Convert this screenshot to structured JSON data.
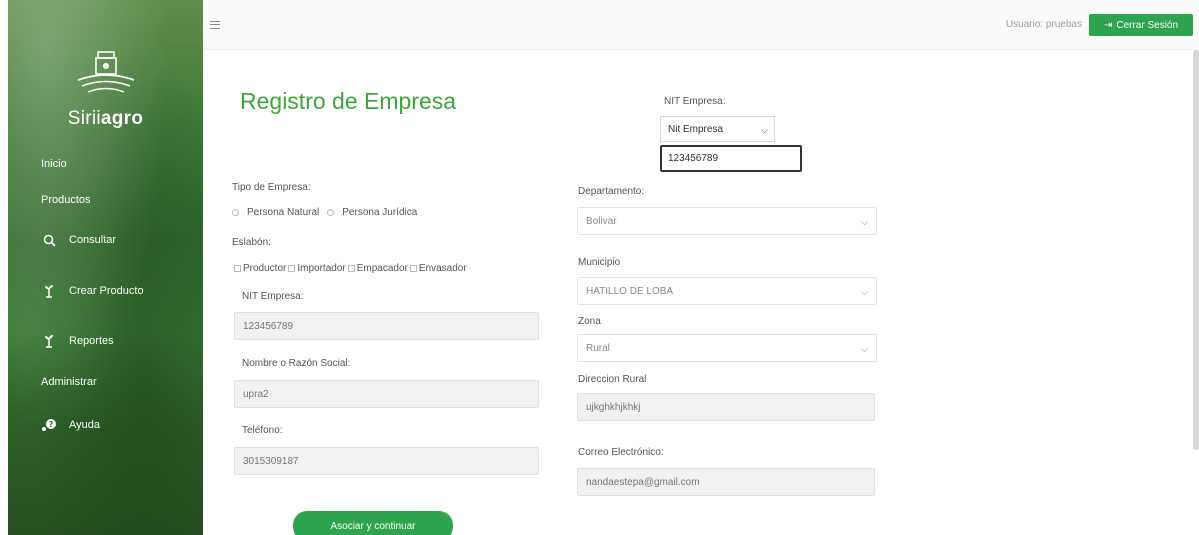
{
  "sidebar": {
    "brand_prefix": "Sirii",
    "brand_bold": "agro",
    "items": [
      {
        "label": "Inicio",
        "icon": ""
      },
      {
        "label": "Productos",
        "icon": ""
      },
      {
        "label": "Consultar",
        "icon": "search-icon"
      },
      {
        "label": "Crear Producto",
        "icon": "plant-icon"
      },
      {
        "label": "Reportes",
        "icon": "plant-icon"
      },
      {
        "label": "Administrar",
        "icon": ""
      },
      {
        "label": "Ayuda",
        "icon": "help-icon"
      }
    ]
  },
  "topbar": {
    "user_label": "Usuario:",
    "user_name": "pruebas",
    "logout_label": "Cerrar Sesión"
  },
  "page": {
    "title": "Registro de Empresa"
  },
  "nit_lookup": {
    "label": "NIT Empresa:",
    "select_value": "Nit Empresa",
    "input_value": "123456789"
  },
  "form": {
    "tipo_label": "Tipo de Empresa:",
    "tipo_options": [
      "Persona Natural",
      "Persona Jurídica"
    ],
    "eslabon_label": "Eslabón:",
    "eslabon_options": [
      "Productor",
      "Importador",
      "Empacador",
      "Envasador"
    ],
    "nit_label": "NIT Empresa:",
    "nit_value": "123456789",
    "nombre_label": "Nombre o Razón Social:",
    "nombre_value": "upra2",
    "telefono_label": "Teléfono:",
    "telefono_value": "3015309187",
    "departamento_label": "Departamento:",
    "departamento_value": "Bolivar",
    "municipio_label": "Municipio",
    "municipio_value": "HATILLO DE LOBA",
    "zona_label": "Zona",
    "zona_value": "Rural",
    "direccion_label": "Direccion Rural",
    "direccion_value": "ujkghkhjkhkj",
    "correo_label": "Correo Electrónico:",
    "correo_value": "nandaestepa@gmail.com",
    "submit_label": "Asociar y continuar"
  },
  "colors": {
    "accent_green": "#2ea44f",
    "title_green": "#3ea63c",
    "sidebar_green": "#2f6a2c"
  }
}
